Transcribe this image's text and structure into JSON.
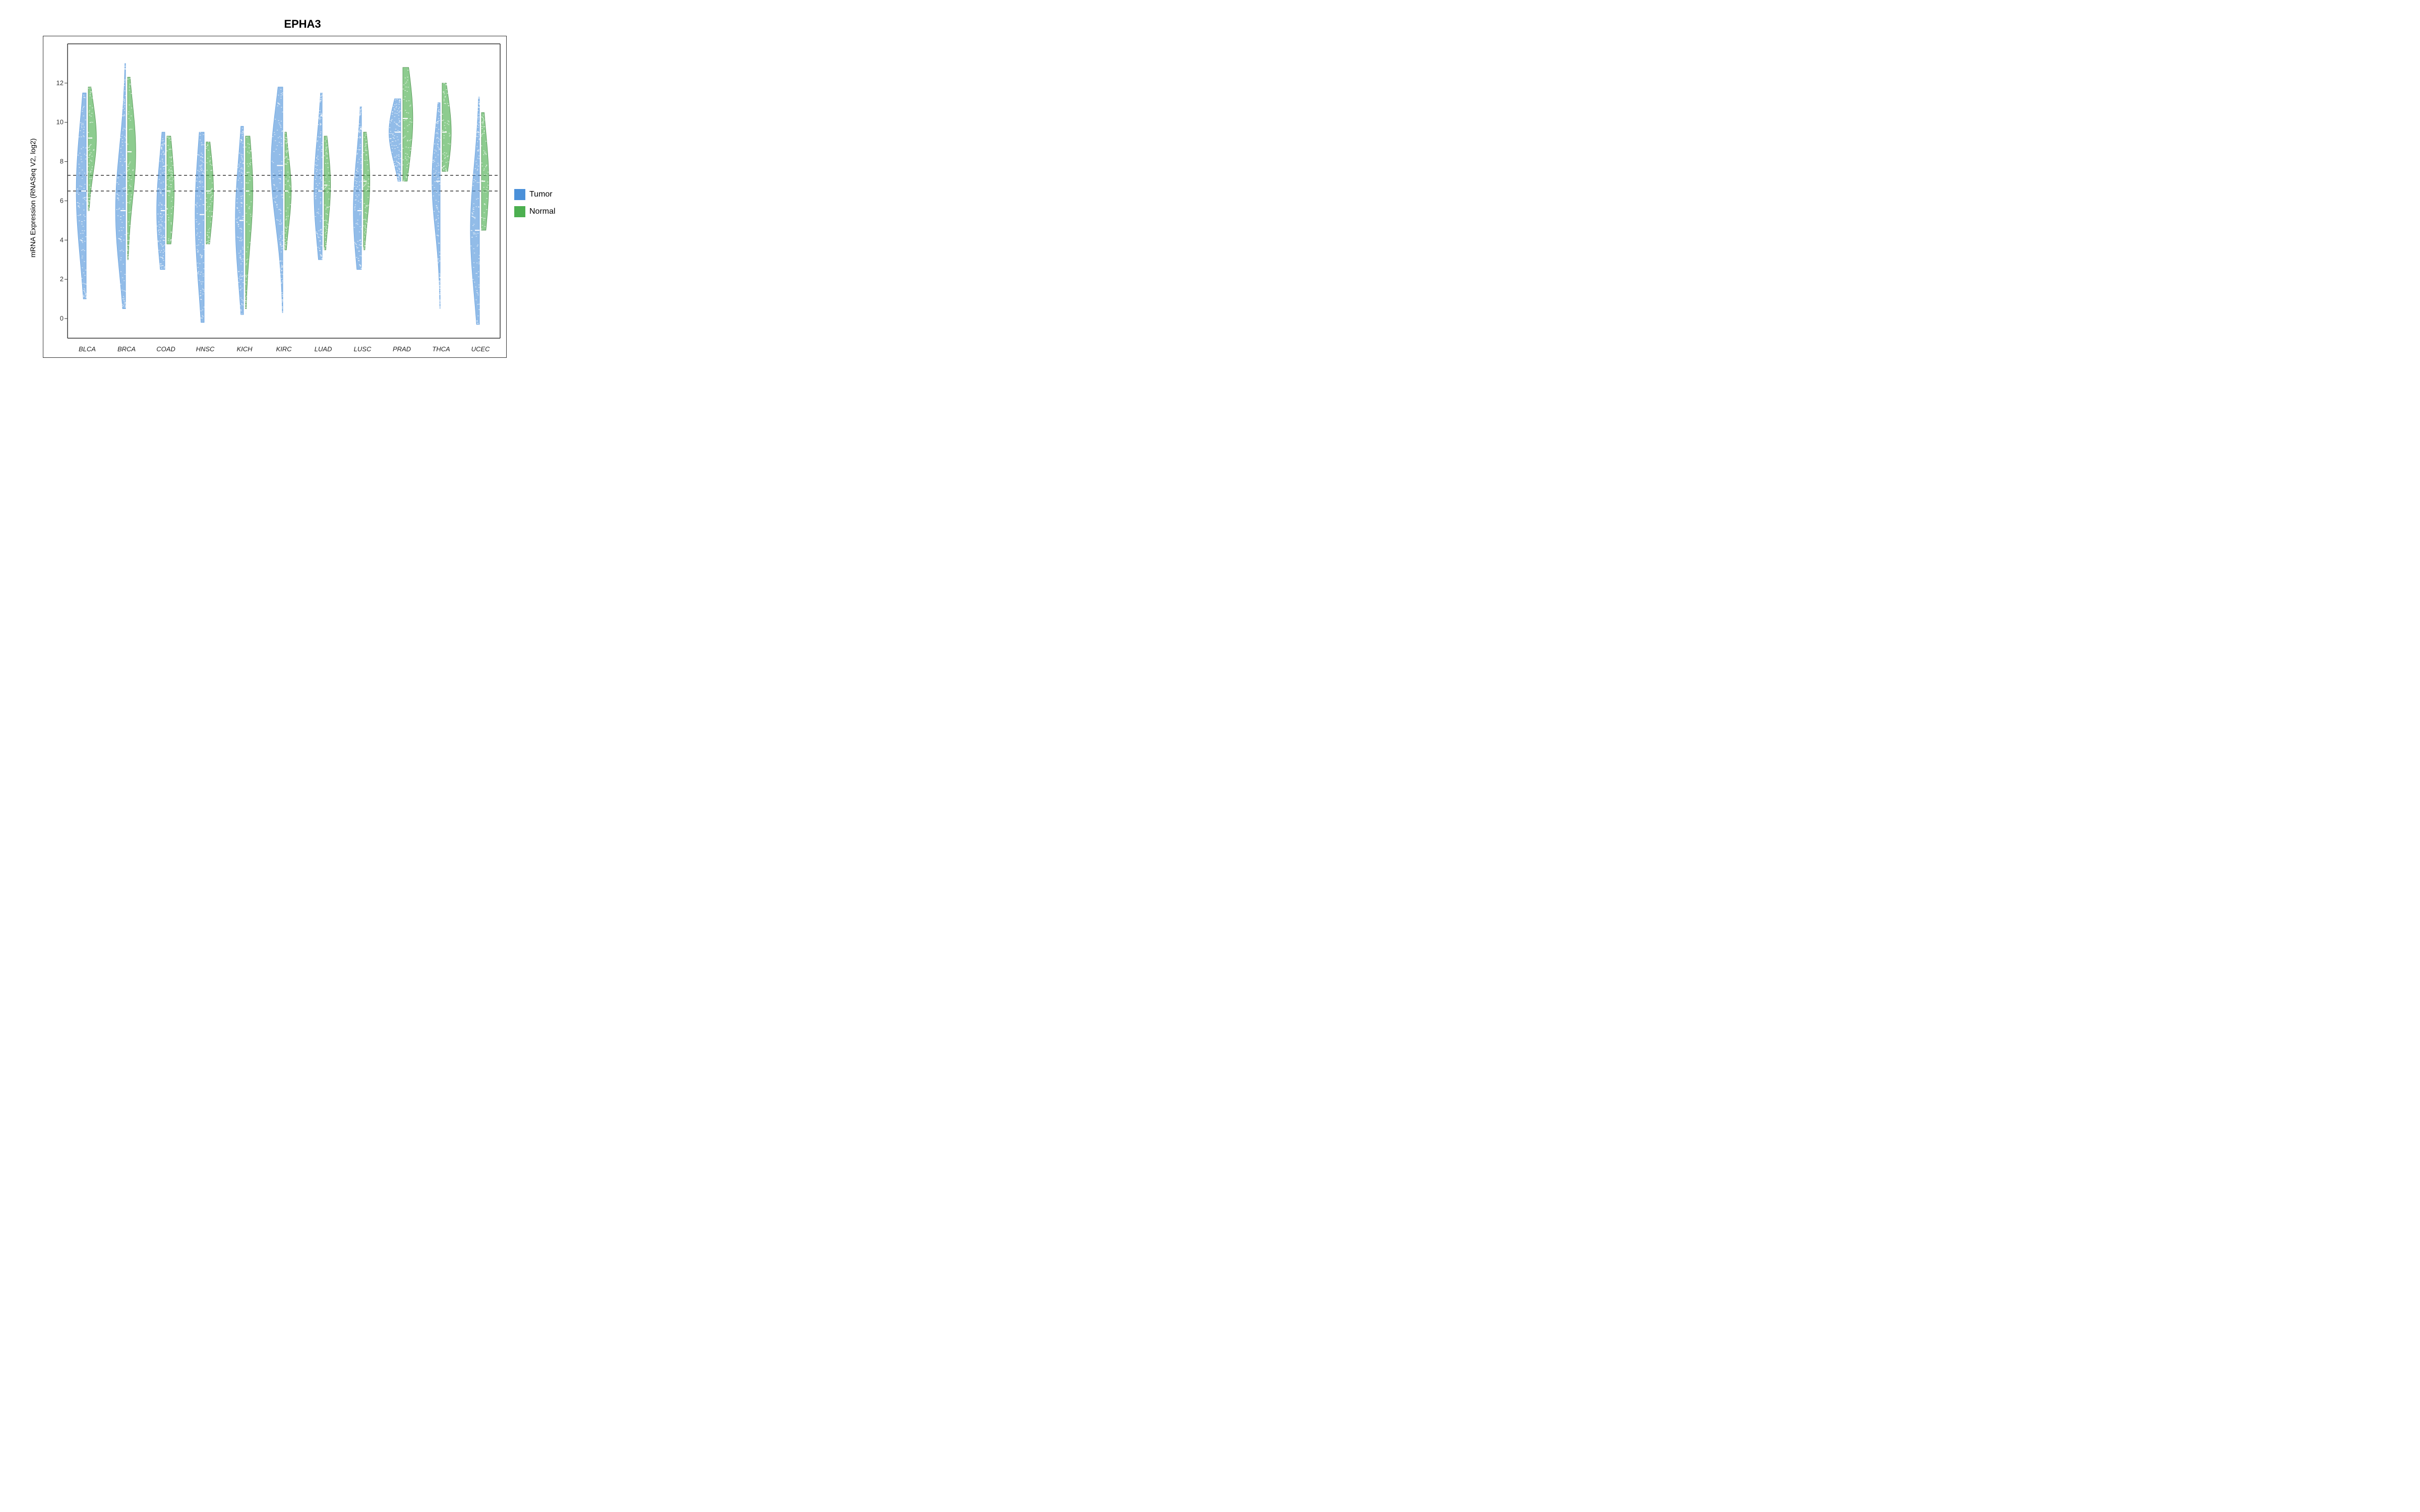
{
  "title": "EPHA3",
  "yAxisLabel": "mRNA Expression (RNASeq V2, log2)",
  "yTicks": [
    0,
    2,
    4,
    6,
    8,
    10,
    12
  ],
  "yMin": -1,
  "yMax": 14,
  "dashedLines": [
    7.3,
    6.5
  ],
  "xLabels": [
    "BLCA",
    "BRCA",
    "COAD",
    "HNSC",
    "KICH",
    "KIRC",
    "LUAD",
    "LUSC",
    "PRAD",
    "THCA",
    "UCEC"
  ],
  "legend": [
    {
      "label": "Tumor",
      "color": "#4a90d9"
    },
    {
      "label": "Normal",
      "color": "#4caf50"
    }
  ],
  "colors": {
    "tumor": "#4a90d9",
    "normal": "#3a8a3a",
    "tumorFill": "rgba(74,144,217,0.7)",
    "normalFill": "rgba(76,175,80,0.75)"
  },
  "violins": {
    "BLCA": {
      "tumor": {
        "center": 6.5,
        "spread": 3.5,
        "top": 11.5,
        "bottom": 1.0,
        "maxWidth": 22
      },
      "normal": {
        "center": 9.2,
        "spread": 1.8,
        "top": 11.8,
        "bottom": 5.5,
        "maxWidth": 18
      }
    },
    "BRCA": {
      "tumor": {
        "center": 5.5,
        "spread": 3.2,
        "top": 13.0,
        "bottom": 0.5,
        "maxWidth": 22
      },
      "normal": {
        "center": 8.5,
        "spread": 2.5,
        "top": 12.3,
        "bottom": 3.0,
        "maxWidth": 18
      }
    },
    "COAD": {
      "tumor": {
        "center": 5.5,
        "spread": 2.8,
        "top": 9.5,
        "bottom": 2.5,
        "maxWidth": 18
      },
      "normal": {
        "center": 6.5,
        "spread": 2.5,
        "top": 9.3,
        "bottom": 3.8,
        "maxWidth": 16
      }
    },
    "HNSC": {
      "tumor": {
        "center": 5.3,
        "spread": 3.8,
        "top": 9.5,
        "bottom": -0.2,
        "maxWidth": 20
      },
      "normal": {
        "center": 6.5,
        "spread": 2.2,
        "top": 9.0,
        "bottom": 3.8,
        "maxWidth": 16
      }
    },
    "KICH": {
      "tumor": {
        "center": 5.0,
        "spread": 3.2,
        "top": 9.8,
        "bottom": 0.2,
        "maxWidth": 18
      },
      "normal": {
        "center": 6.5,
        "spread": 2.8,
        "top": 9.3,
        "bottom": 0.5,
        "maxWidth": 16
      }
    },
    "KIRC": {
      "tumor": {
        "center": 7.8,
        "spread": 3.0,
        "top": 11.8,
        "bottom": 0.3,
        "maxWidth": 26
      },
      "normal": {
        "center": 6.5,
        "spread": 1.8,
        "top": 9.5,
        "bottom": 3.5,
        "maxWidth": 14
      }
    },
    "LUAD": {
      "tumor": {
        "center": 6.5,
        "spread": 2.8,
        "top": 11.5,
        "bottom": 3.0,
        "maxWidth": 18
      },
      "normal": {
        "center": 6.8,
        "spread": 2.0,
        "top": 9.3,
        "bottom": 3.5,
        "maxWidth": 14
      }
    },
    "LUSC": {
      "tumor": {
        "center": 5.5,
        "spread": 2.8,
        "top": 10.8,
        "bottom": 2.5,
        "maxWidth": 18
      },
      "normal": {
        "center": 7.0,
        "spread": 2.0,
        "top": 9.5,
        "bottom": 3.5,
        "maxWidth": 14
      }
    },
    "PRAD": {
      "tumor": {
        "center": 9.5,
        "spread": 1.5,
        "top": 11.2,
        "bottom": 7.0,
        "maxWidth": 26
      },
      "normal": {
        "center": 10.2,
        "spread": 2.5,
        "top": 12.8,
        "bottom": 7.0,
        "maxWidth": 22
      }
    },
    "THCA": {
      "tumor": {
        "center": 7.0,
        "spread": 2.5,
        "top": 11.0,
        "bottom": 0.5,
        "maxWidth": 18
      },
      "normal": {
        "center": 9.5,
        "spread": 2.0,
        "top": 12.0,
        "bottom": 7.5,
        "maxWidth": 20
      }
    },
    "UCEC": {
      "tumor": {
        "center": 4.5,
        "spread": 3.2,
        "top": 11.3,
        "bottom": -0.3,
        "maxWidth": 20
      },
      "normal": {
        "center": 7.0,
        "spread": 2.5,
        "top": 10.5,
        "bottom": 4.5,
        "maxWidth": 16
      }
    }
  }
}
